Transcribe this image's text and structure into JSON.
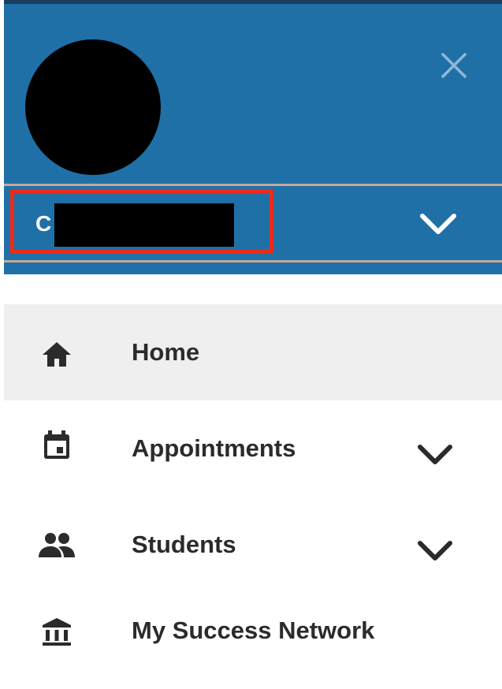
{
  "header": {
    "background_color": "#2070a8",
    "close_icon": "close-icon",
    "user": {
      "initial": "C",
      "name_redacted": true,
      "chevron_icon": "chevron-down-icon",
      "highlight_color": "#ee2a17"
    }
  },
  "nav": {
    "items": [
      {
        "label": "Home",
        "icon": "home-icon",
        "active": true,
        "expandable": false
      },
      {
        "label": "Appointments",
        "icon": "calendar-icon",
        "active": false,
        "expandable": true
      },
      {
        "label": "Students",
        "icon": "people-icon",
        "active": false,
        "expandable": true
      },
      {
        "label": "My Success Network",
        "icon": "institution-icon",
        "active": false,
        "expandable": false
      }
    ]
  }
}
